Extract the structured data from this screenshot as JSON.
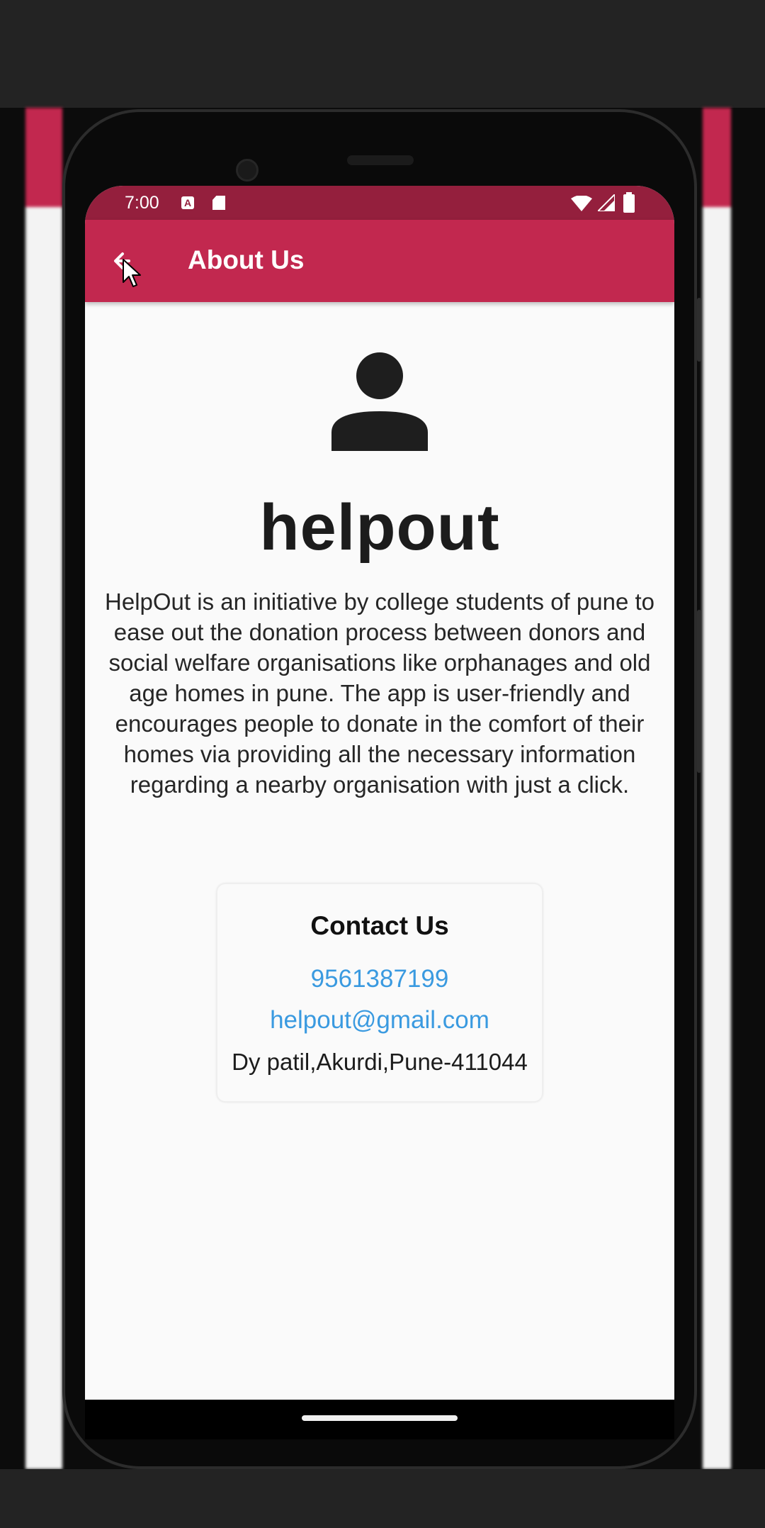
{
  "status_bar": {
    "time": "7:00",
    "icon_names": [
      "a-notification-icon",
      "sd-card-icon",
      "wifi-icon",
      "signal-icon",
      "battery-icon"
    ]
  },
  "app_bar": {
    "title": "About Us",
    "back_icon": "arrow-back-icon",
    "color": "#c2284f",
    "status_color": "#941f3d"
  },
  "content": {
    "avatar_icon": "person-icon",
    "brand": "helpout",
    "description": "HelpOut is an initiative by college students of pune to ease out the donation process between donors and social welfare organisations like orphanages and old age homes in pune. The app is user-friendly and encourages people to donate in the comfort of their homes via providing all the necessary information regarding a nearby organisation with just a click."
  },
  "contact": {
    "title": "Contact Us",
    "phone": "9561387199",
    "email": "helpout@gmail.com",
    "address": "Dy patil,Akurdi,Pune-411044",
    "link_color": "#3a9ae0"
  }
}
